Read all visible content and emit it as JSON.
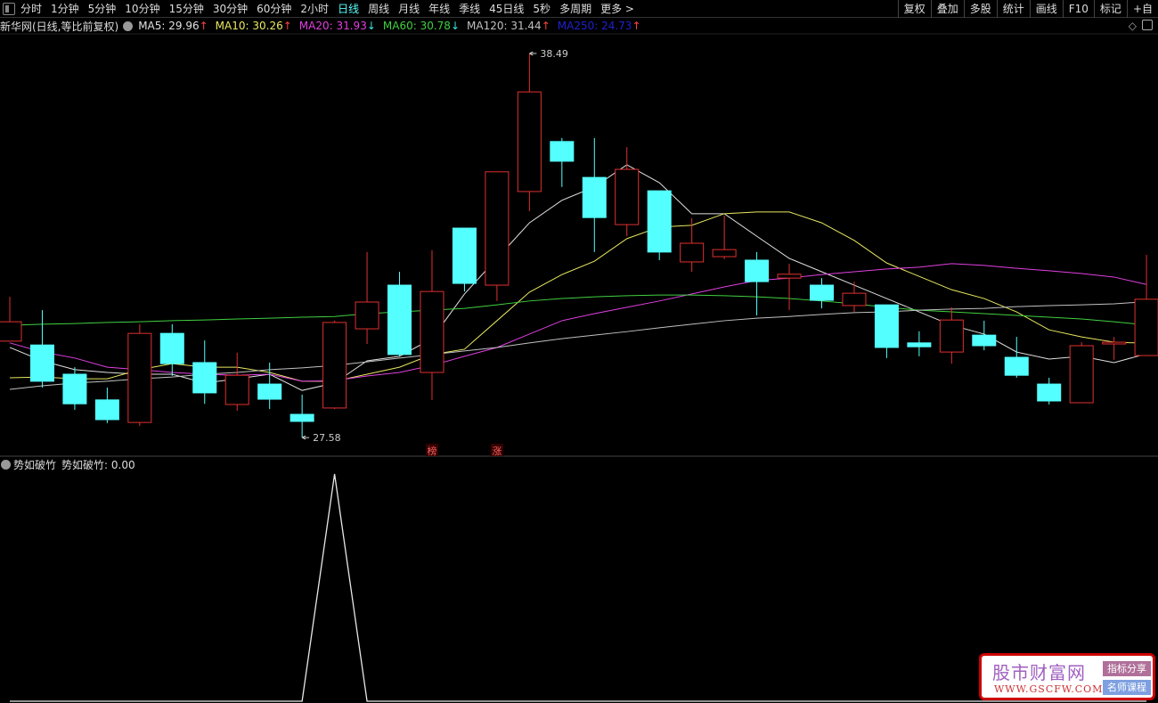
{
  "topbar": {
    "periods": [
      "分时",
      "1分钟",
      "5分钟",
      "10分钟",
      "15分钟",
      "30分钟",
      "60分钟",
      "2小时",
      "日线",
      "周线",
      "月线",
      "年线",
      "季线",
      "45日线",
      "5秒",
      "多周期",
      "更多 >"
    ],
    "active_period": "日线",
    "right_buttons": [
      "复权",
      "叠加",
      "多股",
      "统计",
      "画线",
      "F10",
      "标记",
      "+自"
    ]
  },
  "info": {
    "title": "新华网(日线,等比前复权)",
    "ma": [
      {
        "label": "MA5: 29.96",
        "arrow": "↑",
        "color": "#e0e0e0",
        "arrow_color": "#ff4040"
      },
      {
        "label": "MA10: 30.26",
        "arrow": "↑",
        "color": "#e8e860",
        "arrow_color": "#ff4040"
      },
      {
        "label": "MA20: 31.93",
        "arrow": "↓",
        "color": "#e040e0",
        "arrow_color": "#40e0e0"
      },
      {
        "label": "MA60: 30.78",
        "arrow": "↓",
        "color": "#40d040",
        "arrow_color": "#40e0e0"
      },
      {
        "label": "MA120: 31.44",
        "arrow": "↑",
        "color": "#c0c0c0",
        "arrow_color": "#ff4040"
      },
      {
        "label": "MA250: 24.73",
        "arrow": "↑",
        "color": "#2020d0",
        "arrow_color": "#ff4040"
      }
    ]
  },
  "indicator": {
    "name": "势如破竹",
    "value_label": "势如破竹: 0.00"
  },
  "chart_data": {
    "type": "candlestick",
    "colors": {
      "up": "#e03030",
      "down": "#54ffff"
    },
    "candles": [
      [
        30.32,
        31.58,
        30.32,
        30.87
      ],
      [
        30.21,
        31.2,
        29.0,
        29.18
      ],
      [
        29.38,
        29.58,
        28.37,
        28.54
      ],
      [
        28.65,
        29.0,
        27.99,
        28.09
      ],
      [
        28.01,
        30.8,
        27.91,
        30.54
      ],
      [
        30.54,
        30.8,
        29.33,
        29.68
      ],
      [
        29.71,
        30.34,
        28.54,
        28.85
      ],
      [
        28.52,
        29.99,
        28.34,
        29.35
      ],
      [
        29.1,
        29.71,
        28.39,
        28.67
      ],
      [
        28.24,
        28.8,
        27.58,
        28.04
      ],
      [
        28.42,
        30.9,
        28.39,
        30.85
      ],
      [
        30.67,
        32.85,
        30.24,
        31.43
      ],
      [
        31.91,
        32.29,
        29.89,
        29.94
      ],
      [
        29.43,
        32.9,
        28.65,
        31.73
      ],
      [
        33.53,
        33.53,
        31.73,
        31.96
      ],
      [
        31.91,
        35.13,
        31.46,
        35.13
      ],
      [
        34.57,
        38.49,
        34.01,
        37.4
      ],
      [
        35.99,
        36.09,
        34.7,
        35.43
      ],
      [
        34.97,
        36.09,
        32.85,
        33.83
      ],
      [
        33.63,
        35.83,
        33.3,
        35.2
      ],
      [
        34.59,
        34.59,
        32.62,
        32.85
      ],
      [
        32.57,
        33.81,
        32.29,
        33.1
      ],
      [
        32.72,
        33.89,
        32.65,
        32.92
      ],
      [
        32.62,
        32.85,
        31.05,
        32.01
      ],
      [
        32.11,
        32.52,
        31.2,
        32.22
      ],
      [
        31.91,
        32.11,
        31.25,
        31.48
      ],
      [
        31.33,
        32.01,
        31.15,
        31.68
      ],
      [
        31.35,
        31.35,
        29.84,
        30.14
      ],
      [
        30.27,
        30.6,
        29.89,
        30.16
      ],
      [
        30.01,
        31.28,
        29.68,
        30.92
      ],
      [
        30.49,
        30.9,
        30.06,
        30.19
      ],
      [
        29.86,
        30.44,
        29.28,
        29.35
      ],
      [
        29.1,
        29.28,
        28.52,
        28.62
      ],
      [
        28.57,
        30.29,
        28.57,
        30.19
      ],
      [
        30.24,
        30.44,
        29.79,
        30.29
      ],
      [
        29.91,
        32.77,
        29.91,
        31.51
      ]
    ],
    "ma_series": [
      {
        "name": "MA5",
        "color": "#e0e0e0",
        "values": [
          30.14,
          29.76,
          29.51,
          29.43,
          29.38,
          29.38,
          29.13,
          29.25,
          29.38,
          28.92,
          29.13,
          29.76,
          29.89,
          30.39,
          31.66,
          32.67,
          33.68,
          34.32,
          34.7,
          35.33,
          34.82,
          33.94,
          33.94,
          33.3,
          32.67,
          32.29,
          31.91,
          31.53,
          31.15,
          30.77,
          30.52,
          30.01,
          29.81,
          29.89,
          29.71,
          29.96
        ]
      },
      {
        "name": "MA10",
        "color": "#e8e860",
        "values": [
          29.28,
          29.3,
          29.25,
          29.25,
          29.51,
          29.68,
          29.58,
          29.58,
          29.43,
          29.18,
          29.18,
          29.38,
          29.58,
          29.94,
          30.09,
          30.9,
          31.71,
          32.21,
          32.59,
          33.23,
          33.56,
          33.61,
          33.94,
          33.99,
          33.99,
          33.68,
          33.18,
          32.54,
          32.16,
          31.78,
          31.53,
          31.15,
          30.64,
          30.44,
          30.29,
          30.26
        ]
      },
      {
        "name": "MA20",
        "color": "#e040e0",
        "values": [
          30.27,
          30.01,
          29.84,
          29.58,
          29.51,
          29.43,
          29.38,
          29.35,
          29.38,
          29.18,
          29.2,
          29.33,
          29.43,
          29.63,
          29.89,
          30.14,
          30.52,
          30.9,
          31.1,
          31.28,
          31.46,
          31.66,
          31.86,
          32.04,
          32.11,
          32.21,
          32.29,
          32.37,
          32.42,
          32.52,
          32.47,
          32.39,
          32.32,
          32.24,
          32.14,
          31.93
        ]
      },
      {
        "name": "MA60",
        "color": "#40d040",
        "values": [
          30.77,
          30.8,
          30.82,
          30.85,
          30.87,
          30.9,
          30.92,
          30.95,
          30.97,
          31.0,
          31.02,
          31.1,
          31.15,
          31.2,
          31.25,
          31.35,
          31.46,
          31.53,
          31.58,
          31.61,
          31.63,
          31.63,
          31.61,
          31.58,
          31.53,
          31.46,
          31.38,
          31.28,
          31.2,
          31.15,
          31.1,
          31.05,
          31.0,
          30.95,
          30.87,
          30.78
        ]
      },
      {
        "name": "MA120",
        "color": "#c0c0c0",
        "values": [
          28.95,
          29.05,
          29.13,
          29.18,
          29.25,
          29.3,
          29.38,
          29.43,
          29.51,
          29.56,
          29.63,
          29.73,
          29.84,
          29.94,
          30.04,
          30.14,
          30.27,
          30.39,
          30.49,
          30.59,
          30.7,
          30.8,
          30.9,
          30.97,
          31.02,
          31.08,
          31.13,
          31.15,
          31.2,
          31.23,
          31.25,
          31.3,
          31.33,
          31.35,
          31.38,
          31.44
        ]
      }
    ],
    "annotations": [
      {
        "index": 16,
        "label": "38.49",
        "type": "high"
      },
      {
        "index": 9,
        "label": "27.58",
        "type": "low"
      }
    ],
    "markers": [
      {
        "index": 13,
        "label": "榜"
      },
      {
        "index": 15,
        "label": "涨"
      }
    ],
    "indicator_values": [
      0,
      0,
      0,
      0,
      0,
      0,
      0,
      0,
      0,
      0,
      1,
      0,
      0,
      0,
      0,
      0,
      0,
      0,
      0,
      0,
      0,
      0,
      0,
      0,
      0,
      0,
      0,
      0,
      0,
      0,
      0,
      0,
      0,
      0,
      0,
      0
    ],
    "indicator_range": [
      0,
      1
    ]
  },
  "logo": {
    "title": "股市财富网",
    "url": "WWW.GSCFW.COM",
    "tag1": "指标分享",
    "tag2": "名师课程"
  }
}
